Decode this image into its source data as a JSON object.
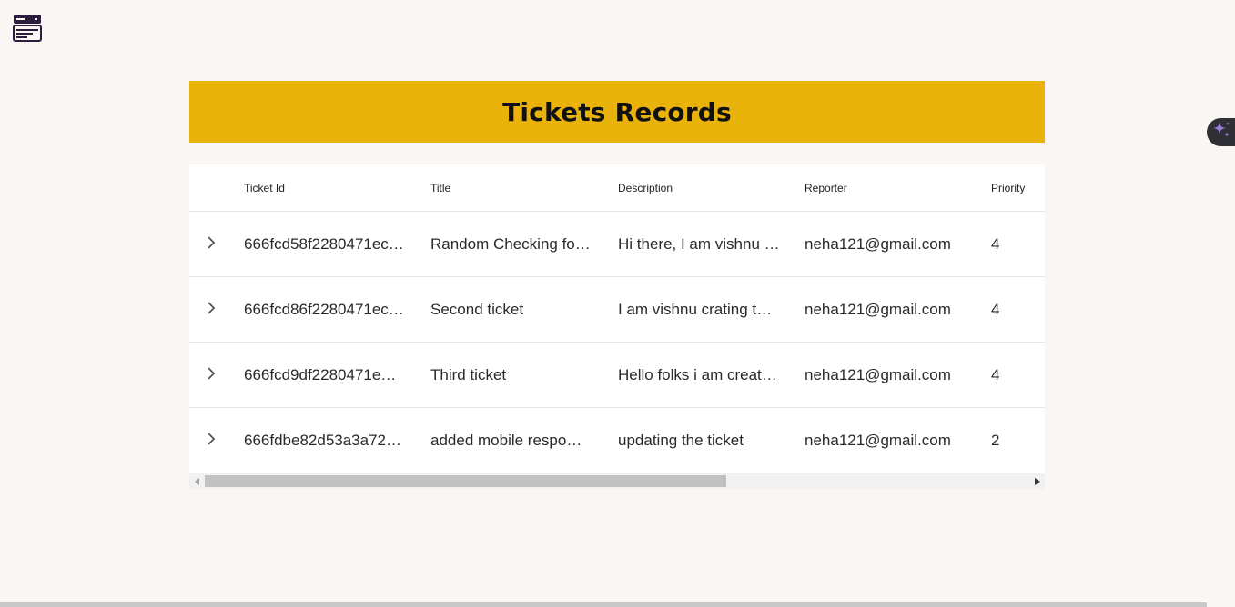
{
  "header": {
    "title": "Tickets Records"
  },
  "table": {
    "columns": [
      "",
      "Ticket Id",
      "Title",
      "Description",
      "Reporter",
      "Priority"
    ],
    "rows": [
      {
        "ticket_id": "666fcd58f2280471ec…",
        "title": "Random Checking fo…",
        "description": "Hi there, I am vishnu …",
        "reporter": "neha121@gmail.com",
        "priority": "4"
      },
      {
        "ticket_id": "666fcd86f2280471ec…",
        "title": "Second ticket",
        "description": "I am vishnu crating t…",
        "reporter": "neha121@gmail.com",
        "priority": "4"
      },
      {
        "ticket_id": "666fcd9df2280471e…",
        "title": "Third ticket",
        "description": "Hello folks i am creat…",
        "reporter": "neha121@gmail.com",
        "priority": "4"
      },
      {
        "ticket_id": "666fdbe82d53a3a72…",
        "title": "added mobile respo…",
        "description": "updating the ticket",
        "reporter": "neha121@gmail.com",
        "priority": "2"
      }
    ]
  },
  "icons": {
    "app": "server-list-icon",
    "row_expand": "chevron-right-icon",
    "assistant": "sparkle-icon",
    "scroll_left": "arrow-left-icon",
    "scroll_right": "arrow-right-icon"
  },
  "colors": {
    "banner": "#e9b30b",
    "background": "#faf6f3",
    "app_icon": "#2b1d3d",
    "assistant_fab": "#2f2f36",
    "sparkle": "#9b7fd4"
  },
  "scrollbar": {
    "horizontal_position_fraction": 0.0,
    "visible_fraction": 0.63
  }
}
